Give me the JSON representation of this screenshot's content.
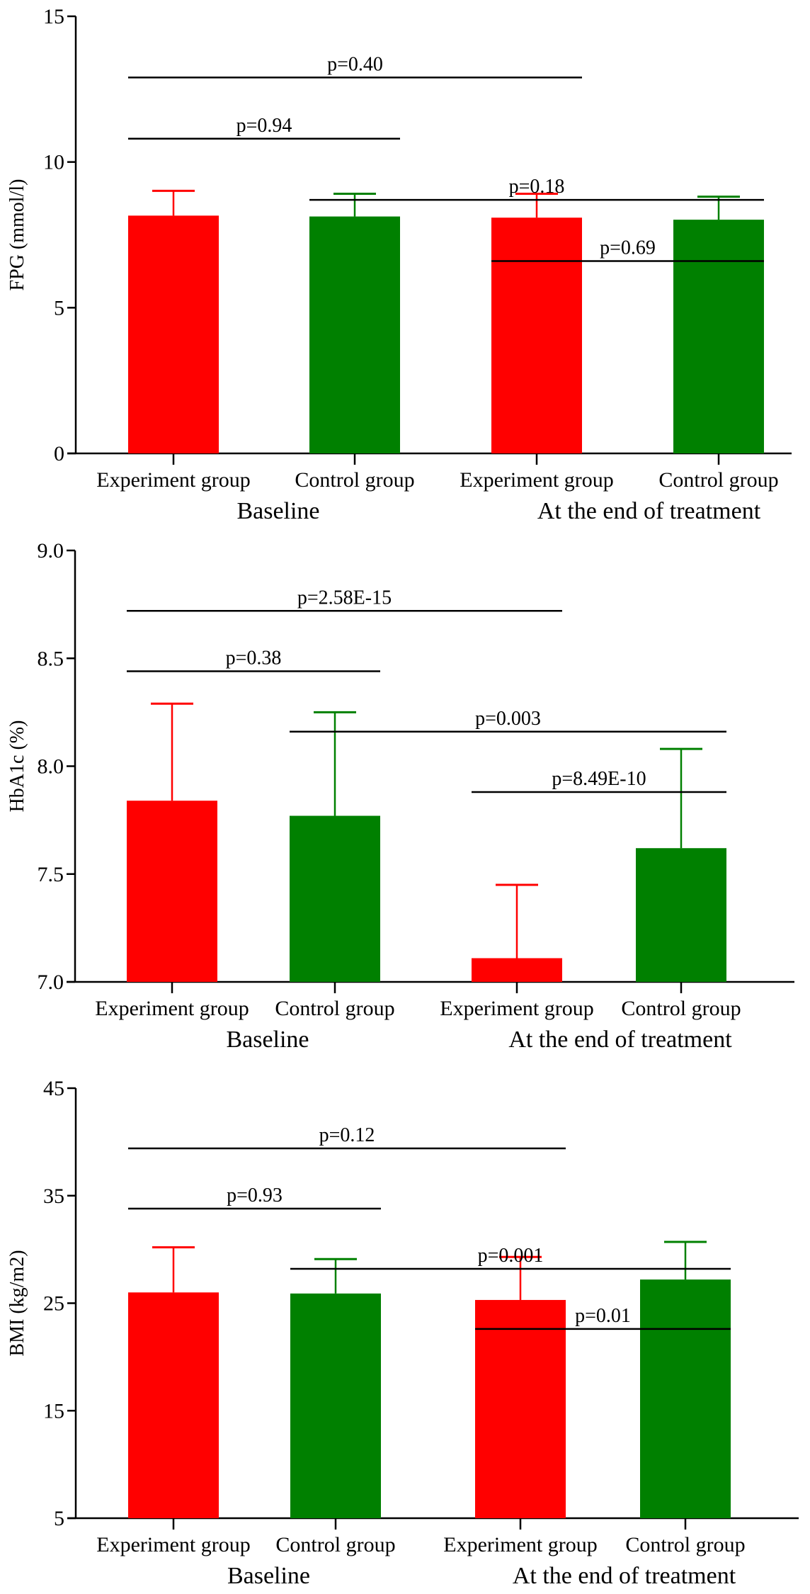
{
  "figure": {
    "colors": {
      "experiment": "#ff0000",
      "control": "#008000",
      "axis": "#000000",
      "bracket": "#000000"
    }
  },
  "chart_data": [
    {
      "type": "bar",
      "id": "fpg",
      "title": "",
      "ylabel": "FPG (mmol/l)",
      "xlabel": "",
      "ylim": [
        0,
        15
      ],
      "yticks": [
        0,
        5,
        10,
        15
      ],
      "ytick_labels": [
        "0",
        "5",
        "10",
        "15"
      ],
      "grid": false,
      "categories": [
        "Experiment group",
        "Control group",
        "Experiment group",
        "Control group"
      ],
      "groups": [
        {
          "label": "Baseline",
          "categories": [
            0,
            1
          ]
        },
        {
          "label": "At the end of treatment",
          "categories": [
            2,
            3
          ]
        }
      ],
      "series_colors": [
        "experiment",
        "control",
        "experiment",
        "control"
      ],
      "values": [
        8.16,
        8.13,
        8.09,
        8.02
      ],
      "error_upper": [
        9.01,
        8.91,
        8.91,
        8.81
      ],
      "comparisons": [
        {
          "from": 0,
          "to": 2,
          "label": "p=0.40",
          "level": 4
        },
        {
          "from": 0,
          "to": 1,
          "label": "p=0.94",
          "level": 3
        },
        {
          "from": 1,
          "to": 3,
          "label": "p=0.18",
          "level": 2
        },
        {
          "from": 2,
          "to": 3,
          "label": "p=0.69",
          "level": 1
        }
      ]
    },
    {
      "type": "bar",
      "id": "hba1c",
      "title": "",
      "ylabel": "HbA1c (%)",
      "xlabel": "",
      "ylim": [
        7.0,
        9.0
      ],
      "yticks": [
        7.0,
        7.5,
        8.0,
        8.5,
        9.0
      ],
      "ytick_labels": [
        "7.0",
        "7.5",
        "8.0",
        "8.5",
        "9.0"
      ],
      "grid": false,
      "categories": [
        "Experiment group",
        "Control group",
        "Experiment group",
        "Control group"
      ],
      "groups": [
        {
          "label": "Baseline",
          "categories": [
            0,
            1
          ]
        },
        {
          "label": "At the end of treatment",
          "categories": [
            2,
            3
          ]
        }
      ],
      "series_colors": [
        "experiment",
        "control",
        "experiment",
        "control"
      ],
      "values": [
        7.84,
        7.77,
        7.11,
        7.62
      ],
      "error_upper": [
        8.29,
        8.25,
        7.45,
        8.08
      ],
      "comparisons": [
        {
          "from": 0,
          "to": 2,
          "label": "p=2.58E-15",
          "level": 4
        },
        {
          "from": 0,
          "to": 1,
          "label": "p=0.38",
          "level": 3
        },
        {
          "from": 1,
          "to": 3,
          "label": "p=0.003",
          "level": 2
        },
        {
          "from": 2,
          "to": 3,
          "label": "p=8.49E-10",
          "level": 1
        }
      ]
    },
    {
      "type": "bar",
      "id": "bmi",
      "title": "",
      "ylabel": "BMI (kg/m2)",
      "xlabel": "",
      "ylim": [
        5,
        45
      ],
      "yticks": [
        5,
        15,
        25,
        35,
        45
      ],
      "ytick_labels": [
        "5",
        "15",
        "25",
        "35",
        "45"
      ],
      "grid": false,
      "categories": [
        "Experiment group",
        "Control group",
        "Experiment group",
        "Control group"
      ],
      "groups": [
        {
          "label": "Baseline",
          "categories": [
            0,
            1
          ]
        },
        {
          "label": "At the end of treatment",
          "categories": [
            2,
            3
          ]
        }
      ],
      "series_colors": [
        "experiment",
        "control",
        "experiment",
        "control"
      ],
      "values": [
        26.0,
        25.9,
        25.3,
        27.2
      ],
      "error_upper": [
        30.2,
        29.1,
        29.3,
        30.7
      ],
      "comparisons": [
        {
          "from": 0,
          "to": 2,
          "label": "p=0.12",
          "level": 4
        },
        {
          "from": 0,
          "to": 1,
          "label": "p=0.93",
          "level": 3
        },
        {
          "from": 1,
          "to": 3,
          "label": "p=0.001",
          "level": 2
        },
        {
          "from": 2,
          "to": 3,
          "label": "p=0.01",
          "level": 1
        }
      ]
    }
  ]
}
